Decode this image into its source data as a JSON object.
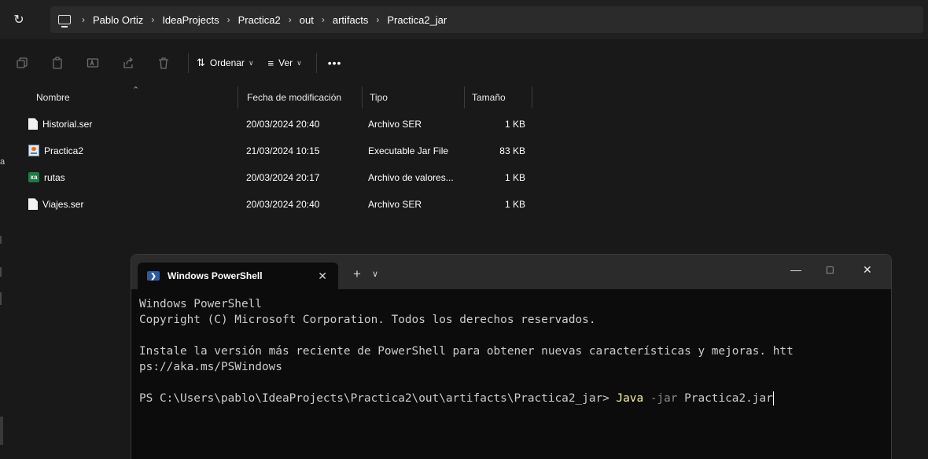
{
  "address_bar": {
    "breadcrumbs": [
      "Pablo Ortiz",
      "IdeaProjects",
      "Practica2",
      "out",
      "artifacts",
      "Practica2_jar"
    ]
  },
  "toolbar": {
    "sort_label": "Ordenar",
    "view_label": "Ver"
  },
  "file_list": {
    "columns": [
      "Nombre",
      "Fecha de modificación",
      "Tipo",
      "Tamaño"
    ],
    "rows": [
      {
        "name": "Historial.ser",
        "date": "20/03/2024 20:40",
        "type": "Archivo SER",
        "size": "1 KB",
        "icon": "file-icon"
      },
      {
        "name": "Practica2",
        "date": "21/03/2024 10:15",
        "type": "Executable Jar File",
        "size": "83 KB",
        "icon": "java-jar-icon"
      },
      {
        "name": "rutas",
        "date": "20/03/2024 20:17",
        "type": "Archivo de valores...",
        "size": "1 KB",
        "icon": "excel-csv-icon"
      },
      {
        "name": "Viajes.ser",
        "date": "20/03/2024 20:40",
        "type": "Archivo SER",
        "size": "1 KB",
        "icon": "file-icon"
      }
    ]
  },
  "left_fragment": "a",
  "terminal": {
    "tab_title": "Windows PowerShell",
    "lines": [
      "Windows PowerShell",
      "Copyright (C) Microsoft Corporation. Todos los derechos reservados.",
      "",
      "Instale la versión más reciente de PowerShell para obtener nuevas características y mejoras. htt",
      "ps://aka.ms/PSWindows",
      ""
    ],
    "prompt": "PS C:\\Users\\pablo\\IdeaProjects\\Practica2\\out\\artifacts\\Practica2_jar> ",
    "command_word": "Java",
    "command_flag": "-jar",
    "command_arg": "Practica2.jar"
  },
  "colors": {
    "explorer_bg": "#191919",
    "terminal_bg": "#0c0c0c",
    "command_yellow": "#f9f1a5"
  }
}
